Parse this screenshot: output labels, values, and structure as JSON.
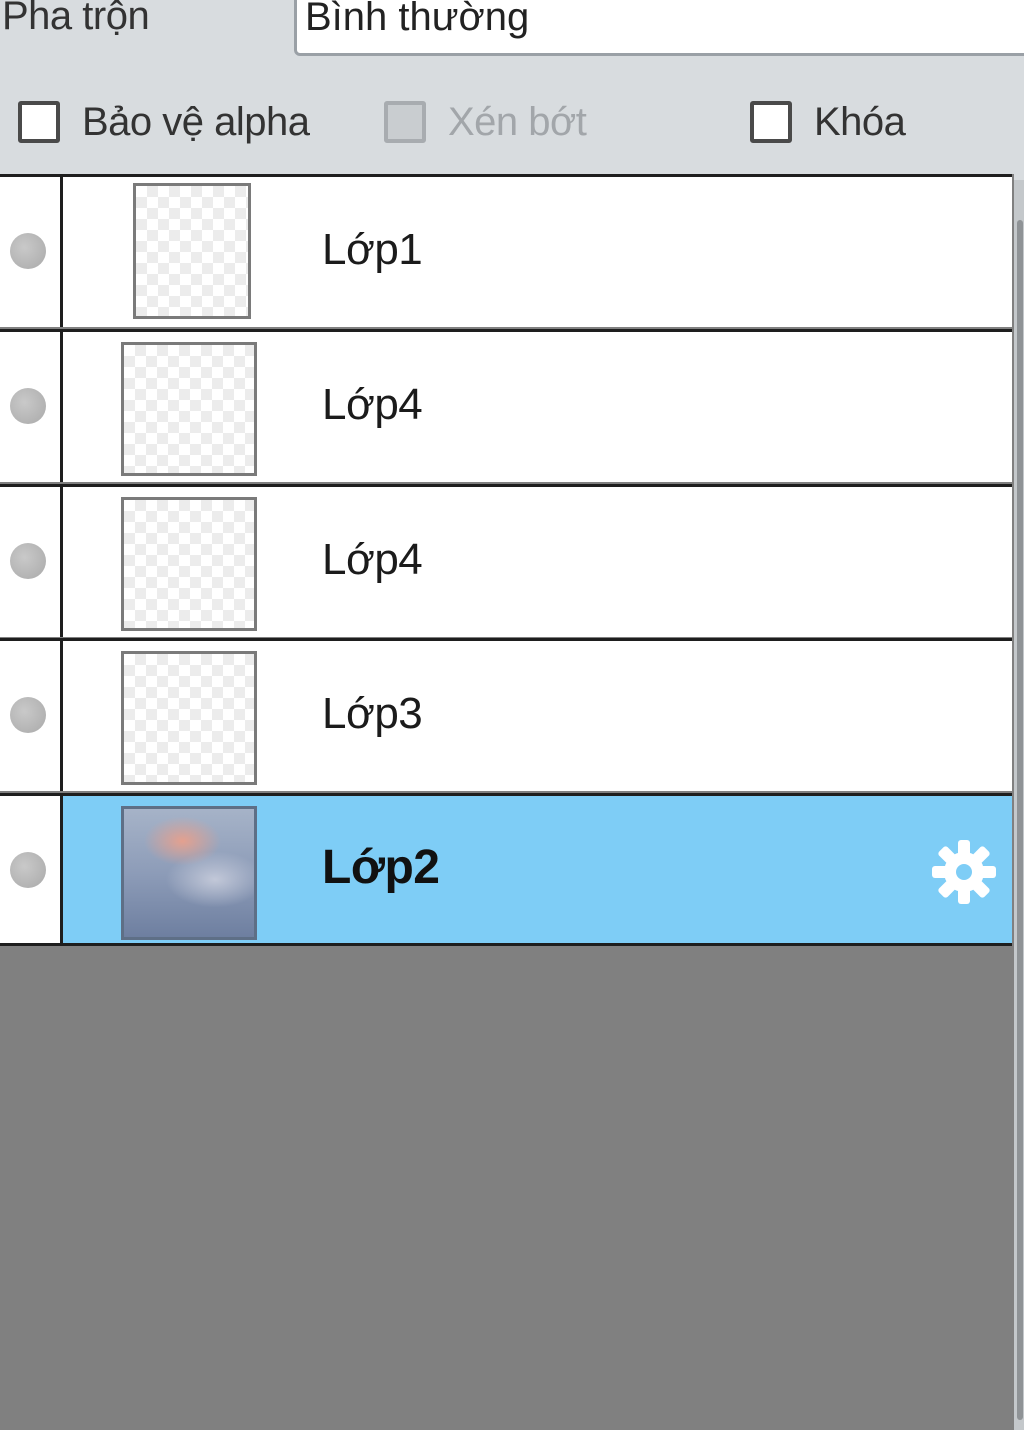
{
  "blend": {
    "label": "Pha trộn",
    "value": "Bình thường"
  },
  "options": {
    "protect_alpha": {
      "label": "Bảo vệ alpha",
      "checked": false,
      "enabled": true
    },
    "clip": {
      "label": "Xén bớt",
      "checked": false,
      "enabled": false
    },
    "lock": {
      "label": "Khóa",
      "checked": false,
      "enabled": true
    }
  },
  "layers": [
    {
      "name": "Lớp1",
      "thumbnail": "transparent",
      "selected": false
    },
    {
      "name": "Lớp4",
      "thumbnail": "transparent",
      "selected": false
    },
    {
      "name": "Lớp4",
      "thumbnail": "transparent",
      "selected": false
    },
    {
      "name": "Lớp3",
      "thumbnail": "transparent",
      "selected": false
    },
    {
      "name": "Lớp2",
      "thumbnail": "sky-photo",
      "selected": true
    }
  ],
  "colors": {
    "selected_row": "#7ecdf6",
    "empty_area": "#808080",
    "panel_bg": "#d8dcdf"
  },
  "icons": {
    "visibility": "visibility-dot-icon",
    "settings": "gear-icon"
  }
}
